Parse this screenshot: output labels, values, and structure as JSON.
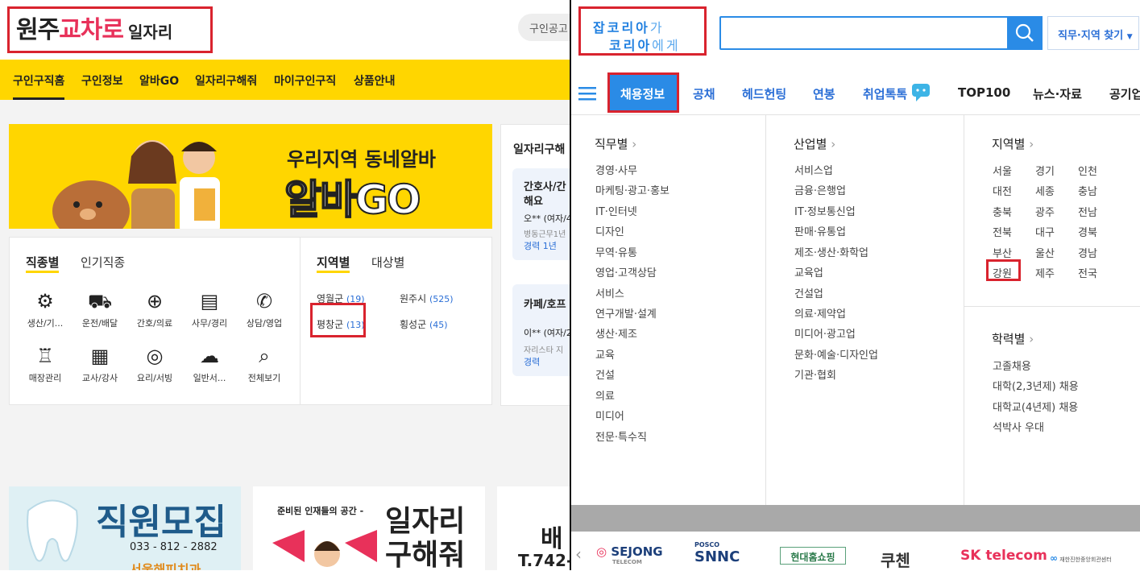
{
  "left": {
    "logo": {
      "part1": "원주",
      "part2": "교차로",
      "part3": "일자리"
    },
    "search_placeholder": "구인공고",
    "nav": [
      "구인구직홈",
      "구인정보",
      "알바GO",
      "일자리구해줘",
      "마이구인구직",
      "상품안내"
    ],
    "banner": {
      "line1": "우리지역 동네알바",
      "line2": "알바GO"
    },
    "category_tabs": [
      "직종별",
      "인기직종"
    ],
    "region_tabs": [
      "지역별",
      "대상별"
    ],
    "categories": [
      {
        "label": "생산/기...",
        "icon": "gear-icon"
      },
      {
        "label": "운전/배달",
        "icon": "truck-icon"
      },
      {
        "label": "간호/의료",
        "icon": "medical-kit-icon"
      },
      {
        "label": "사무/경리",
        "icon": "office-desk-icon"
      },
      {
        "label": "상담/영업",
        "icon": "phone-bubble-icon"
      },
      {
        "label": "매장관리",
        "icon": "shirt-icon"
      },
      {
        "label": "교사/강사",
        "icon": "teacher-board-icon"
      },
      {
        "label": "요리/서빙",
        "icon": "dish-icon"
      },
      {
        "label": "일반서...",
        "icon": "chat-icon"
      },
      {
        "label": "전체보기",
        "icon": "search-icon"
      }
    ],
    "regions": [
      {
        "name": "영월군",
        "count": "(19)"
      },
      {
        "name": "원주시",
        "count": "(525)"
      },
      {
        "name": "평창군",
        "count": "(13)"
      },
      {
        "name": "횡성군",
        "count": "(45)"
      }
    ],
    "job_panel": {
      "title": "일자리구해",
      "card1": {
        "title1": "간호사/간",
        "title2": "해요",
        "person": "오** (여자/4",
        "desc": "병동근무1년",
        "exp": "경력 1년"
      },
      "card2": {
        "title1": "카페/호프",
        "person": "이** (여자/2",
        "desc": "자리스타 지",
        "exp": "경력"
      }
    },
    "ads": [
      {
        "title": "직원모집",
        "phone": "033 - 812 - 2882",
        "extra": "서울해피치과"
      },
      {
        "small": "준비된 인재들의 공간 -",
        "title1": "일자리",
        "title2": "구해줘"
      },
      {
        "title": "배",
        "phone": "T.742-"
      }
    ]
  },
  "right": {
    "logo": {
      "line1a": "잡코리아",
      "line1b": "가",
      "line2a": "코리아",
      "line2b": "에게"
    },
    "find_button": "직무·지역 찾기",
    "nav": [
      "채용정보",
      "공채",
      "헤드헌팅",
      "연봉",
      "취업톡톡",
      "TOP100",
      "뉴스·자료",
      "공기업"
    ],
    "menu": {
      "job": {
        "title": "직무별",
        "items": [
          "경영·사무",
          "마케팅·광고·홍보",
          "IT·인터넷",
          "디자인",
          "무역·유통",
          "영업·고객상담",
          "서비스",
          "연구개발·설계",
          "생산·제조",
          "교육",
          "건설",
          "의료",
          "미디어",
          "전문·특수직"
        ]
      },
      "industry": {
        "title": "산업별",
        "items": [
          "서비스업",
          "금융·은행업",
          "IT·정보통신업",
          "판매·유통업",
          "제조·생산·화학업",
          "교육업",
          "건설업",
          "의료·제약업",
          "미디어·광고업",
          "문화·예술·디자인업",
          "기관·협회"
        ]
      },
      "region": {
        "title": "지역별",
        "items": [
          "서울",
          "경기",
          "인천",
          "대전",
          "세종",
          "충남",
          "충북",
          "광주",
          "전남",
          "전북",
          "대구",
          "경북",
          "부산",
          "울산",
          "경남",
          "강원",
          "제주",
          "전국"
        ]
      },
      "education": {
        "title": "학력별",
        "items": [
          "고졸채용",
          "대학(2,3년제) 채용",
          "대학교(4년제) 채용",
          "석박사 우대"
        ]
      }
    },
    "brands": [
      "SEJONG",
      "TELECOM",
      "POSCO",
      "SNNC",
      "현대홈쇼핑",
      "쿠첸",
      "SK telecom",
      "재한진한중앙회관센터"
    ]
  },
  "colors": {
    "brand_red": "#e8315a",
    "yellow": "#ffd600",
    "jk_blue": "#2a8be6",
    "highlight_red": "#d9232e"
  }
}
